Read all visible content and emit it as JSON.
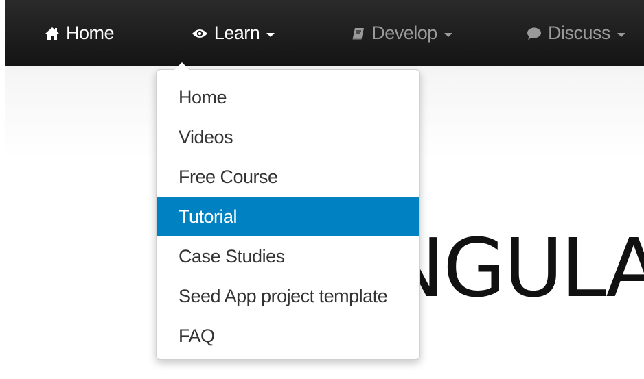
{
  "colors": {
    "navbar_bg": "#1b1b1b",
    "nav_active_text": "#ffffff",
    "nav_muted_text": "#9a9a9a",
    "highlight": "#0081c2",
    "menu_text": "#333333"
  },
  "navbar": {
    "items": [
      {
        "label": "Home",
        "icon": "home-icon",
        "has_caret": false
      },
      {
        "label": "Learn",
        "icon": "eye-icon",
        "has_caret": true
      },
      {
        "label": "Develop",
        "icon": "book-icon",
        "has_caret": true
      },
      {
        "label": "Discuss",
        "icon": "comment-icon",
        "has_caret": true
      }
    ]
  },
  "dropdown": {
    "highlighted_item": "Tutorial",
    "items": [
      {
        "label": "Home"
      },
      {
        "label": "Videos"
      },
      {
        "label": "Free Course"
      },
      {
        "label": "Tutorial"
      },
      {
        "label": "Case Studies"
      },
      {
        "label": "Seed App project template"
      },
      {
        "label": "FAQ"
      }
    ]
  },
  "hero": {
    "visible_text": "NGULA"
  }
}
